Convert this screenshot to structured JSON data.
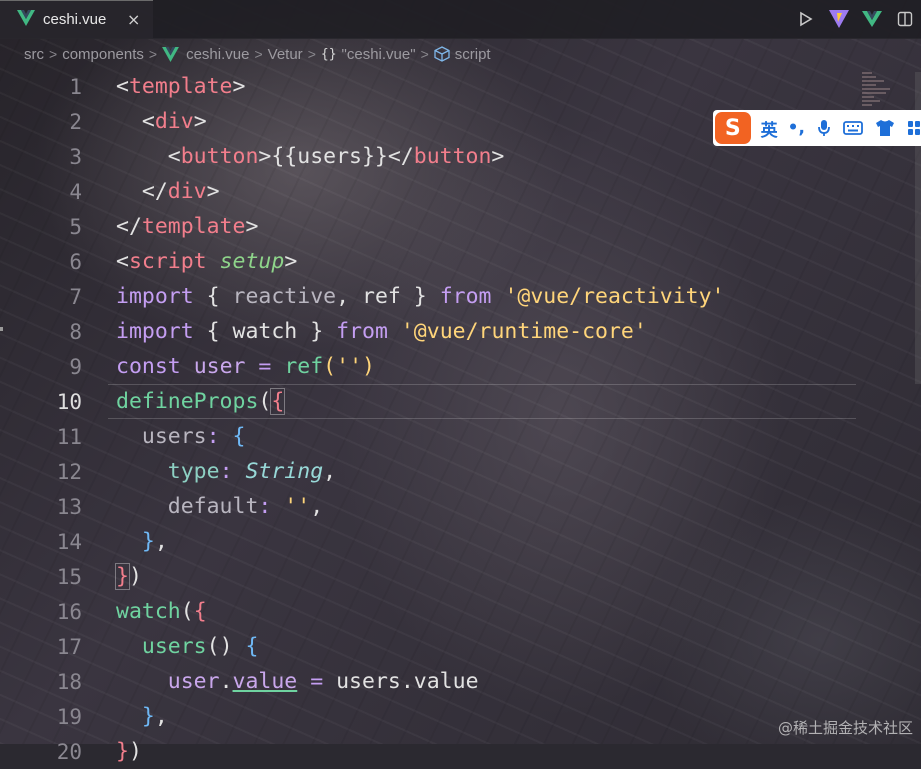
{
  "tab": {
    "title": "ceshi.vue",
    "close": "×"
  },
  "breadcrumb": {
    "items": [
      "src",
      "components",
      "ceshi.vue",
      "Vetur",
      "\"ceshi.vue\"",
      "script"
    ],
    "separator": ">",
    "braces": "{}"
  },
  "ime": {
    "lang_label": "英",
    "punct_label": "•,"
  },
  "editor": {
    "active_line": 10,
    "lines": [
      {
        "n": "1"
      },
      {
        "n": "2"
      },
      {
        "n": "3"
      },
      {
        "n": "4"
      },
      {
        "n": "5"
      },
      {
        "n": "6"
      },
      {
        "n": "7"
      },
      {
        "n": "8"
      },
      {
        "n": "9"
      },
      {
        "n": "10"
      },
      {
        "n": "11"
      },
      {
        "n": "12"
      },
      {
        "n": "13"
      },
      {
        "n": "14"
      },
      {
        "n": "15"
      },
      {
        "n": "16"
      },
      {
        "n": "17"
      },
      {
        "n": "18"
      },
      {
        "n": "19"
      },
      {
        "n": "20"
      }
    ],
    "tokens": {
      "l1": [
        "<",
        "template",
        ">"
      ],
      "l2": [
        "<",
        "div",
        ">"
      ],
      "l3": [
        "<",
        "button",
        ">",
        "{{users}}",
        "</",
        "button",
        ">"
      ],
      "l4": [
        "</",
        "div",
        ">"
      ],
      "l5": [
        "</",
        "template",
        ">"
      ],
      "l6": [
        "<",
        "script",
        "setup",
        ">"
      ],
      "l7": [
        "import",
        "{",
        "reactive",
        ",",
        "ref",
        "}",
        "from",
        "'@vue/reactivity'"
      ],
      "l8": [
        "import",
        "{",
        "watch",
        "}",
        "from",
        "'@vue/runtime-core'"
      ],
      "l9": [
        "const",
        "user",
        "=",
        "ref",
        "(",
        "''",
        ")"
      ],
      "l10": [
        "defineProps",
        "(",
        "{"
      ],
      "l11": [
        "users",
        ":",
        "{"
      ],
      "l12": [
        "type",
        ":",
        "String",
        ","
      ],
      "l13": [
        "default",
        ":",
        "''",
        ","
      ],
      "l14": [
        "}",
        ","
      ],
      "l15": [
        "}",
        ")"
      ],
      "l16": [
        "watch",
        "(",
        "{"
      ],
      "l17": [
        "users",
        "()",
        "{"
      ],
      "l18": [
        "user",
        ".",
        "value",
        "=",
        "users",
        ".",
        "value"
      ],
      "l19": [
        "}",
        ","
      ],
      "l20": [
        "}",
        ")"
      ]
    }
  },
  "watermark": "@稀土掘金技术社区",
  "colors": {
    "tag": "#f27e8c",
    "keyword": "#c49ef2",
    "function": "#6fd3a0",
    "string": "#ffd57a",
    "accent_vue": "#41b883",
    "ime_brand": "#f26322",
    "ime_blue": "#1e6fd8"
  },
  "icons": {
    "tab": "vue-logo-icon",
    "actions": [
      "run-icon",
      "vite-icon",
      "vue-devtools-icon",
      "split-editor-icon"
    ],
    "breadcrumb": [
      "vue-logo-icon",
      "braces-icon",
      "cube-icon"
    ],
    "ime": [
      "sogou-logo-icon",
      "microphone-icon",
      "keyboard-icon",
      "skin-shirt-icon",
      "toolbox-icon"
    ]
  }
}
